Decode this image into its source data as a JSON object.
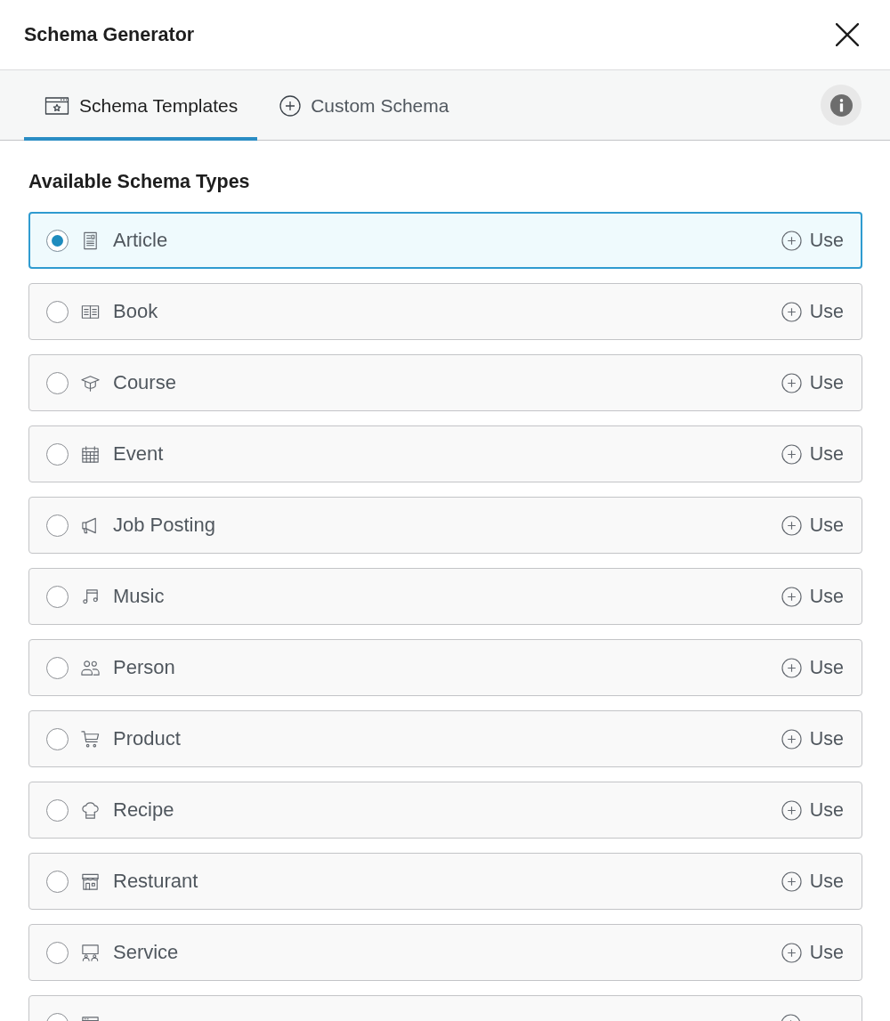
{
  "window": {
    "title": "Schema Generator"
  },
  "tabs": [
    {
      "label": "Schema Templates",
      "kind": "templates",
      "selected": true
    },
    {
      "label": "Custom Schema",
      "kind": "custom",
      "selected": false
    }
  ],
  "section_title": "Available Schema Types",
  "schema_types": [
    {
      "label": "Article",
      "kind": "article",
      "selected": true,
      "action": "Use"
    },
    {
      "label": "Book",
      "kind": "book",
      "selected": false,
      "action": "Use"
    },
    {
      "label": "Course",
      "kind": "course",
      "selected": false,
      "action": "Use"
    },
    {
      "label": "Event",
      "kind": "event",
      "selected": false,
      "action": "Use"
    },
    {
      "label": "Job Posting",
      "kind": "job",
      "selected": false,
      "action": "Use"
    },
    {
      "label": "Music",
      "kind": "music",
      "selected": false,
      "action": "Use"
    },
    {
      "label": "Person",
      "kind": "person",
      "selected": false,
      "action": "Use"
    },
    {
      "label": "Product",
      "kind": "product",
      "selected": false,
      "action": "Use"
    },
    {
      "label": "Recipe",
      "kind": "recipe",
      "selected": false,
      "action": "Use"
    },
    {
      "label": "Resturant",
      "kind": "restaurant",
      "selected": false,
      "action": "Use"
    },
    {
      "label": "Service",
      "kind": "service",
      "selected": false,
      "action": "Use"
    },
    {
      "kind": "software",
      "selected": false
    }
  ]
}
